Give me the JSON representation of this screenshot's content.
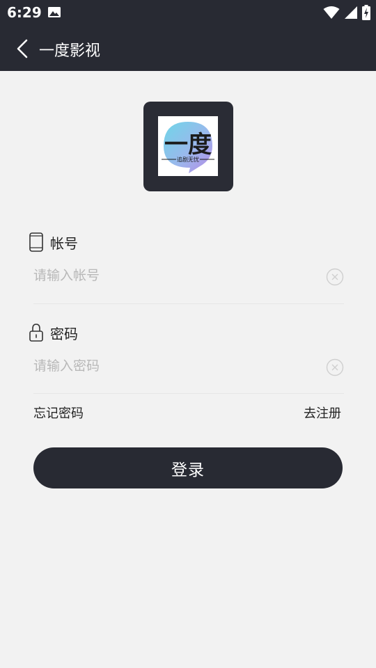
{
  "status_bar": {
    "time": "6:29",
    "icons": [
      "image-icon",
      "wifi-icon",
      "signal-icon",
      "battery-charging-icon"
    ]
  },
  "app_bar": {
    "title": "一度影视",
    "back_icon": "chevron-left-icon"
  },
  "logo": {
    "main_text": "一度",
    "sub_text": "追剧无忧"
  },
  "form": {
    "account": {
      "label": "帐号",
      "icon": "phone-icon",
      "placeholder": "请输入帐号",
      "value": ""
    },
    "password": {
      "label": "密码",
      "icon": "lock-icon",
      "placeholder": "请输入密码",
      "value": ""
    },
    "forgot_password": "忘记密码",
    "register": "去注册",
    "login_button": "登录"
  },
  "colors": {
    "dark": "#282a33",
    "background": "#f2f2f2",
    "placeholder": "#b8b8b8",
    "logo_gradient_1": "#6fd6e8",
    "logo_gradient_2": "#a98be8"
  }
}
